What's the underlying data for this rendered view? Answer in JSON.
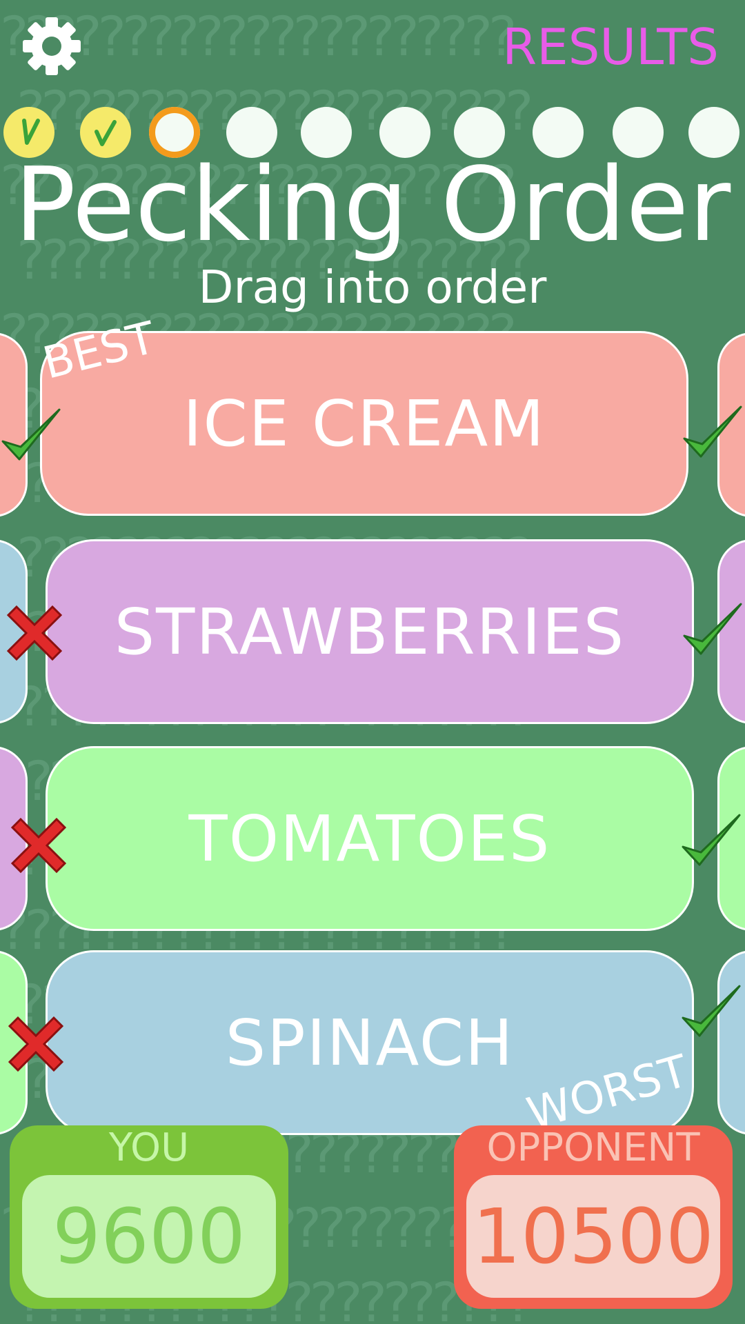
{
  "header": {
    "settings_icon": "gear-icon",
    "results_label": "RESULTS"
  },
  "progress": {
    "rounds": [
      "done",
      "done",
      "current",
      "pending",
      "pending",
      "pending",
      "pending",
      "pending",
      "pending",
      "pending"
    ],
    "done_color": "#f5ea6a",
    "current_ring_color": "#f39b1c"
  },
  "game": {
    "title": "Pecking Order",
    "subtitle": "Drag into order",
    "best_label": "BEST",
    "worst_label": "WORST"
  },
  "items": [
    {
      "label": "ICE CREAM",
      "color": "#f8aaa2",
      "left_mark": "check-icon",
      "right_mark": "check-icon"
    },
    {
      "label": "STRAWBERRIES",
      "color": "#d8a8e0",
      "left_mark": "cross-icon",
      "right_mark": "check-icon"
    },
    {
      "label": "TOMATOES",
      "color": "#aafca4",
      "left_mark": "cross-icon",
      "right_mark": "check-icon"
    },
    {
      "label": "SPINACH",
      "color": "#a8d0e0",
      "left_mark": "cross-icon",
      "right_mark": "check-icon"
    }
  ],
  "scores": {
    "you_label": "YOU",
    "you_value": "9600",
    "opponent_label": "OPPONENT",
    "opponent_value": "10500"
  }
}
